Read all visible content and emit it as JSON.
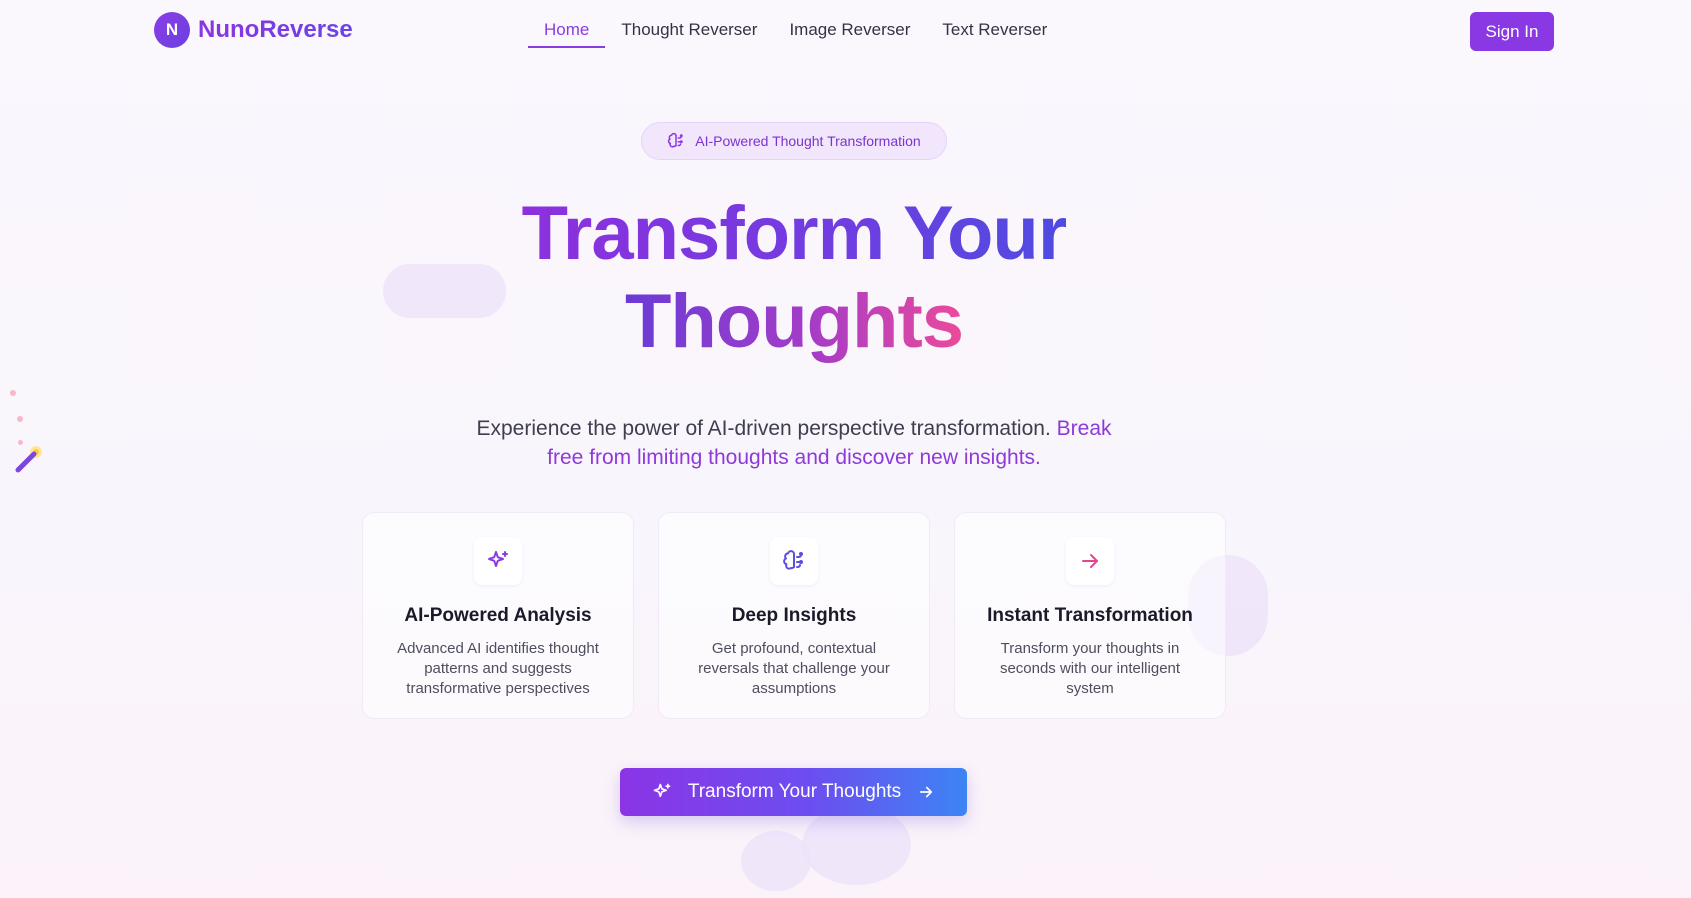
{
  "brand": {
    "logo_letter": "N",
    "name": "NunoReverse"
  },
  "nav": {
    "items": [
      {
        "label": "Home",
        "active": true
      },
      {
        "label": "Thought Reverser",
        "active": false
      },
      {
        "label": "Image Reverser",
        "active": false
      },
      {
        "label": "Text Reverser",
        "active": false
      }
    ]
  },
  "header": {
    "signin_label": "Sign In"
  },
  "hero": {
    "pill_icon": "brain-icon",
    "pill_text": "AI-Powered Thought Transformation",
    "title_line1": "Transform Your",
    "title_line2": "Thoughts",
    "subtitle_plain": "Experience the power of AI-driven perspective transformation.",
    "subtitle_accent": "Break free from limiting thoughts and discover new insights."
  },
  "features": [
    {
      "icon": "sparkles-icon",
      "title": "AI-Powered Analysis",
      "description": "Advanced AI identifies thought patterns and suggests transformative perspectives"
    },
    {
      "icon": "brain-icon",
      "title": "Deep Insights",
      "description": "Get profound, contextual reversals that challenge your assumptions"
    },
    {
      "icon": "arrow-right-icon",
      "title": "Instant Transformation",
      "description": "Transform your thoughts in seconds with our intelligent system"
    }
  ],
  "cta": {
    "label": "Transform Your Thoughts",
    "left_icon": "sparkles-icon",
    "right_icon": "arrow-right-icon"
  },
  "colors": {
    "accent_purple": "#8a38e4",
    "accent_pink": "#ec4a9a",
    "accent_blue": "#3d84f4"
  }
}
